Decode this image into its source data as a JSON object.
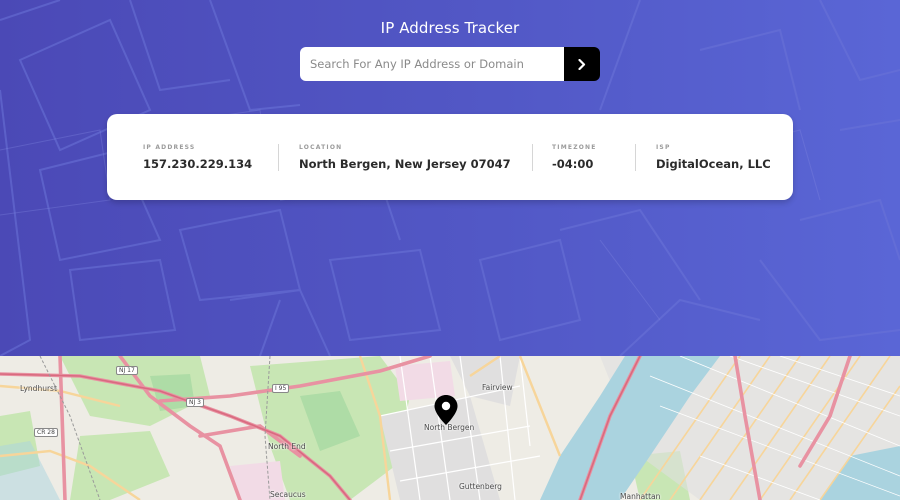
{
  "header": {
    "title": "IP Address Tracker"
  },
  "search": {
    "placeholder": "Search For Any IP Address or Domain",
    "value": "",
    "submit_icon": "chevron-right-icon"
  },
  "info": [
    {
      "label": "IP ADDRESS",
      "value": "157.230.229.134"
    },
    {
      "label": "LOCATION",
      "value": "North Bergen, New Jersey 07047"
    },
    {
      "label": "TIMEZONE",
      "value": "-04:00"
    },
    {
      "label": "ISP",
      "value": "DigitalOcean, LLC"
    }
  ],
  "map": {
    "marker_icon": "location-pin-icon",
    "places": {
      "lyndhurst": "Lyndhurst",
      "north_end": "North End",
      "north_bergen": "North Bergen",
      "fairview": "Fairview",
      "secaucus": "Secaucus",
      "guttenberg": "Guttenberg",
      "manhattan": "Manhattan"
    },
    "routes": {
      "nj17": "NJ 17",
      "nj3": "NJ 3",
      "i95": "I 95",
      "cr28": "CR 28"
    }
  },
  "colors": {
    "header_gradient_start": "#4b49b6",
    "header_gradient_end": "#5a66d6",
    "button": "#000000",
    "card": "#ffffff",
    "label_gray": "#9b9b9b",
    "value_dark": "#2b2b2b",
    "water": "#aad3df",
    "park": "#c8e6b4",
    "road_major": "#e892a2",
    "road_secondary": "#f7d59a"
  }
}
